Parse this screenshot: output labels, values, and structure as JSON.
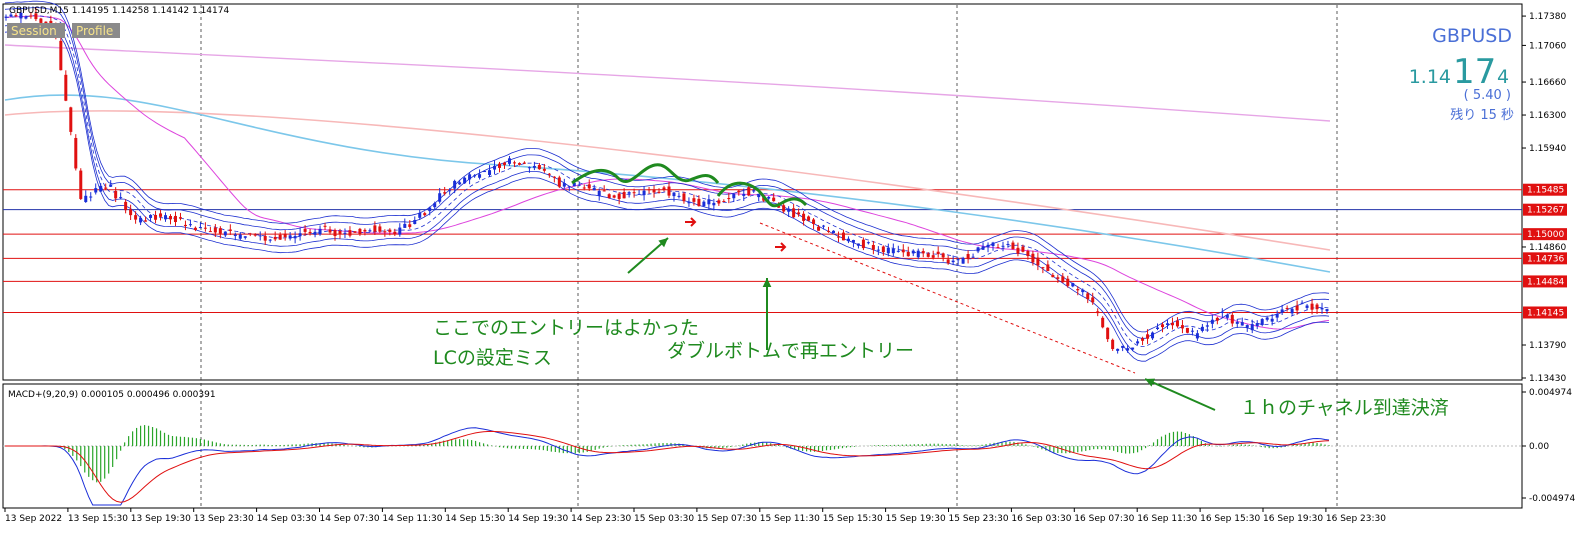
{
  "window": {
    "header": "GBPUSD,M15  1.14195 1.14258 1.14142 1.14174",
    "buttons": [
      "Session",
      "Profile"
    ]
  },
  "symbol_panel": {
    "symbol": "GBPUSD",
    "price_prefix": "1.14",
    "price_big": "17",
    "price_suffix": "4",
    "spread": "( 5.40 )",
    "remaining": "残り 15 秒"
  },
  "annotations": {
    "note1_line1": "ここでのエントリーはよかった",
    "note1_line2": "LCの設定ミス",
    "note2": "ダブルボトムで再エントリー",
    "note3": "１ｈのチャネル到達決済"
  },
  "macd_panel": {
    "header": "MACD+(9,20,9) 0.000105 0.000496 0.000391",
    "ticks": [
      "0.004974",
      "0.00",
      "-0.004974"
    ]
  },
  "colors": {
    "bull": "#1a2ed8",
    "bear": "#e01010",
    "level": "#e01010",
    "annotation": "#1f8a1f",
    "ma_pink": "#e6a6e6",
    "ma_salmon": "#f7b8b8",
    "ma_sky": "#7cc7ea",
    "bands": "#1d2fd0",
    "macd_hist": "#2aa52a"
  },
  "chart_data": {
    "type": "candlestick",
    "symbol": "GBPUSD",
    "timeframe": "M15",
    "last": {
      "open": 1.14195,
      "high": 1.14258,
      "low": 1.14142,
      "close": 1.14174
    },
    "ylim": [
      1.1343,
      1.1749
    ],
    "y_ticks": [
      "1.17380",
      "1.17060",
      "1.16660",
      "1.16300",
      "1.15940",
      "1.15485",
      "1.15267",
      "1.15000",
      "1.14860",
      "1.14736",
      "1.14484",
      "1.14145",
      "1.13790",
      "1.13430"
    ],
    "x_ticks": [
      "13 Sep 2022",
      "13 Sep 15:30",
      "13 Sep 19:30",
      "13 Sep 23:30",
      "14 Sep 03:30",
      "14 Sep 07:30",
      "14 Sep 11:30",
      "14 Sep 15:30",
      "14 Sep 19:30",
      "14 Sep 23:30",
      "15 Sep 03:30",
      "15 Sep 07:30",
      "15 Sep 11:30",
      "15 Sep 15:30",
      "15 Sep 19:30",
      "15 Sep 23:30",
      "16 Sep 03:30",
      "16 Sep 07:30",
      "16 Sep 11:30",
      "16 Sep 15:30",
      "16 Sep 19:30",
      "16 Sep 23:30"
    ],
    "levels": [
      1.15485,
      1.15267,
      1.15,
      1.14736,
      1.14484,
      1.14145
    ],
    "price_path": [
      1.1735,
      1.174,
      1.1725,
      1.1535,
      1.1555,
      1.1515,
      1.152,
      1.151,
      1.1503,
      1.1498,
      1.1495,
      1.15,
      1.1505,
      1.15,
      1.1507,
      1.1503,
      1.1525,
      1.1555,
      1.1565,
      1.158,
      1.1575,
      1.1555,
      1.155,
      1.154,
      1.1545,
      1.1548,
      1.1535,
      1.1535,
      1.1548,
      1.1538,
      1.152,
      1.1505,
      1.1493,
      1.1485,
      1.1478,
      1.1478,
      1.147,
      1.1485,
      1.149,
      1.147,
      1.145,
      1.1432,
      1.137,
      1.1385,
      1.1405,
      1.139,
      1.1413,
      1.1398,
      1.1412,
      1.1421,
      1.1417
    ]
  }
}
